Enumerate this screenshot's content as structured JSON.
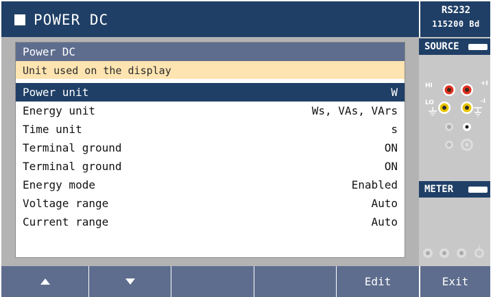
{
  "header": {
    "title": "POWER DC",
    "port": "RS232",
    "baud": "115200 Bd"
  },
  "dialog": {
    "title": "Power DC",
    "description": "Unit used on the display",
    "rows": [
      {
        "label": "Power unit",
        "value": "W",
        "selected": true
      },
      {
        "label": "Energy unit",
        "value": "Ws, VAs, VArs",
        "selected": false
      },
      {
        "label": "Time unit",
        "value": "s",
        "selected": false
      },
      {
        "label": "Terminal ground",
        "value": "ON",
        "selected": false
      },
      {
        "label": "Terminal ground",
        "value": "ON",
        "selected": false
      },
      {
        "label": "Energy mode",
        "value": "Enabled",
        "selected": false
      },
      {
        "label": "Voltage range",
        "value": "Auto",
        "selected": false
      },
      {
        "label": "Current range",
        "value": "Auto",
        "selected": false
      }
    ]
  },
  "right_panel": {
    "source_label": "SOURCE",
    "meter_label": "METER",
    "jack_labels": {
      "hi": "HI",
      "lo": "LO",
      "plus_i": "+I",
      "minus_i": "-I"
    }
  },
  "buttons": [
    {
      "label": "",
      "icon": "up-arrow-icon"
    },
    {
      "label": "",
      "icon": "down-arrow-icon"
    },
    {
      "label": ""
    },
    {
      "label": ""
    },
    {
      "label": "Edit"
    },
    {
      "label": "Exit"
    }
  ],
  "colors": {
    "header_bg": "#1f3f66",
    "dialog_title_bg": "#5e6d8e",
    "description_bg": "#fde4b1",
    "selected_row_bg": "#1f3f66",
    "button_bg": "#5e6d8e",
    "jack_red": "#e03020",
    "jack_yellow": "#e8c400"
  }
}
